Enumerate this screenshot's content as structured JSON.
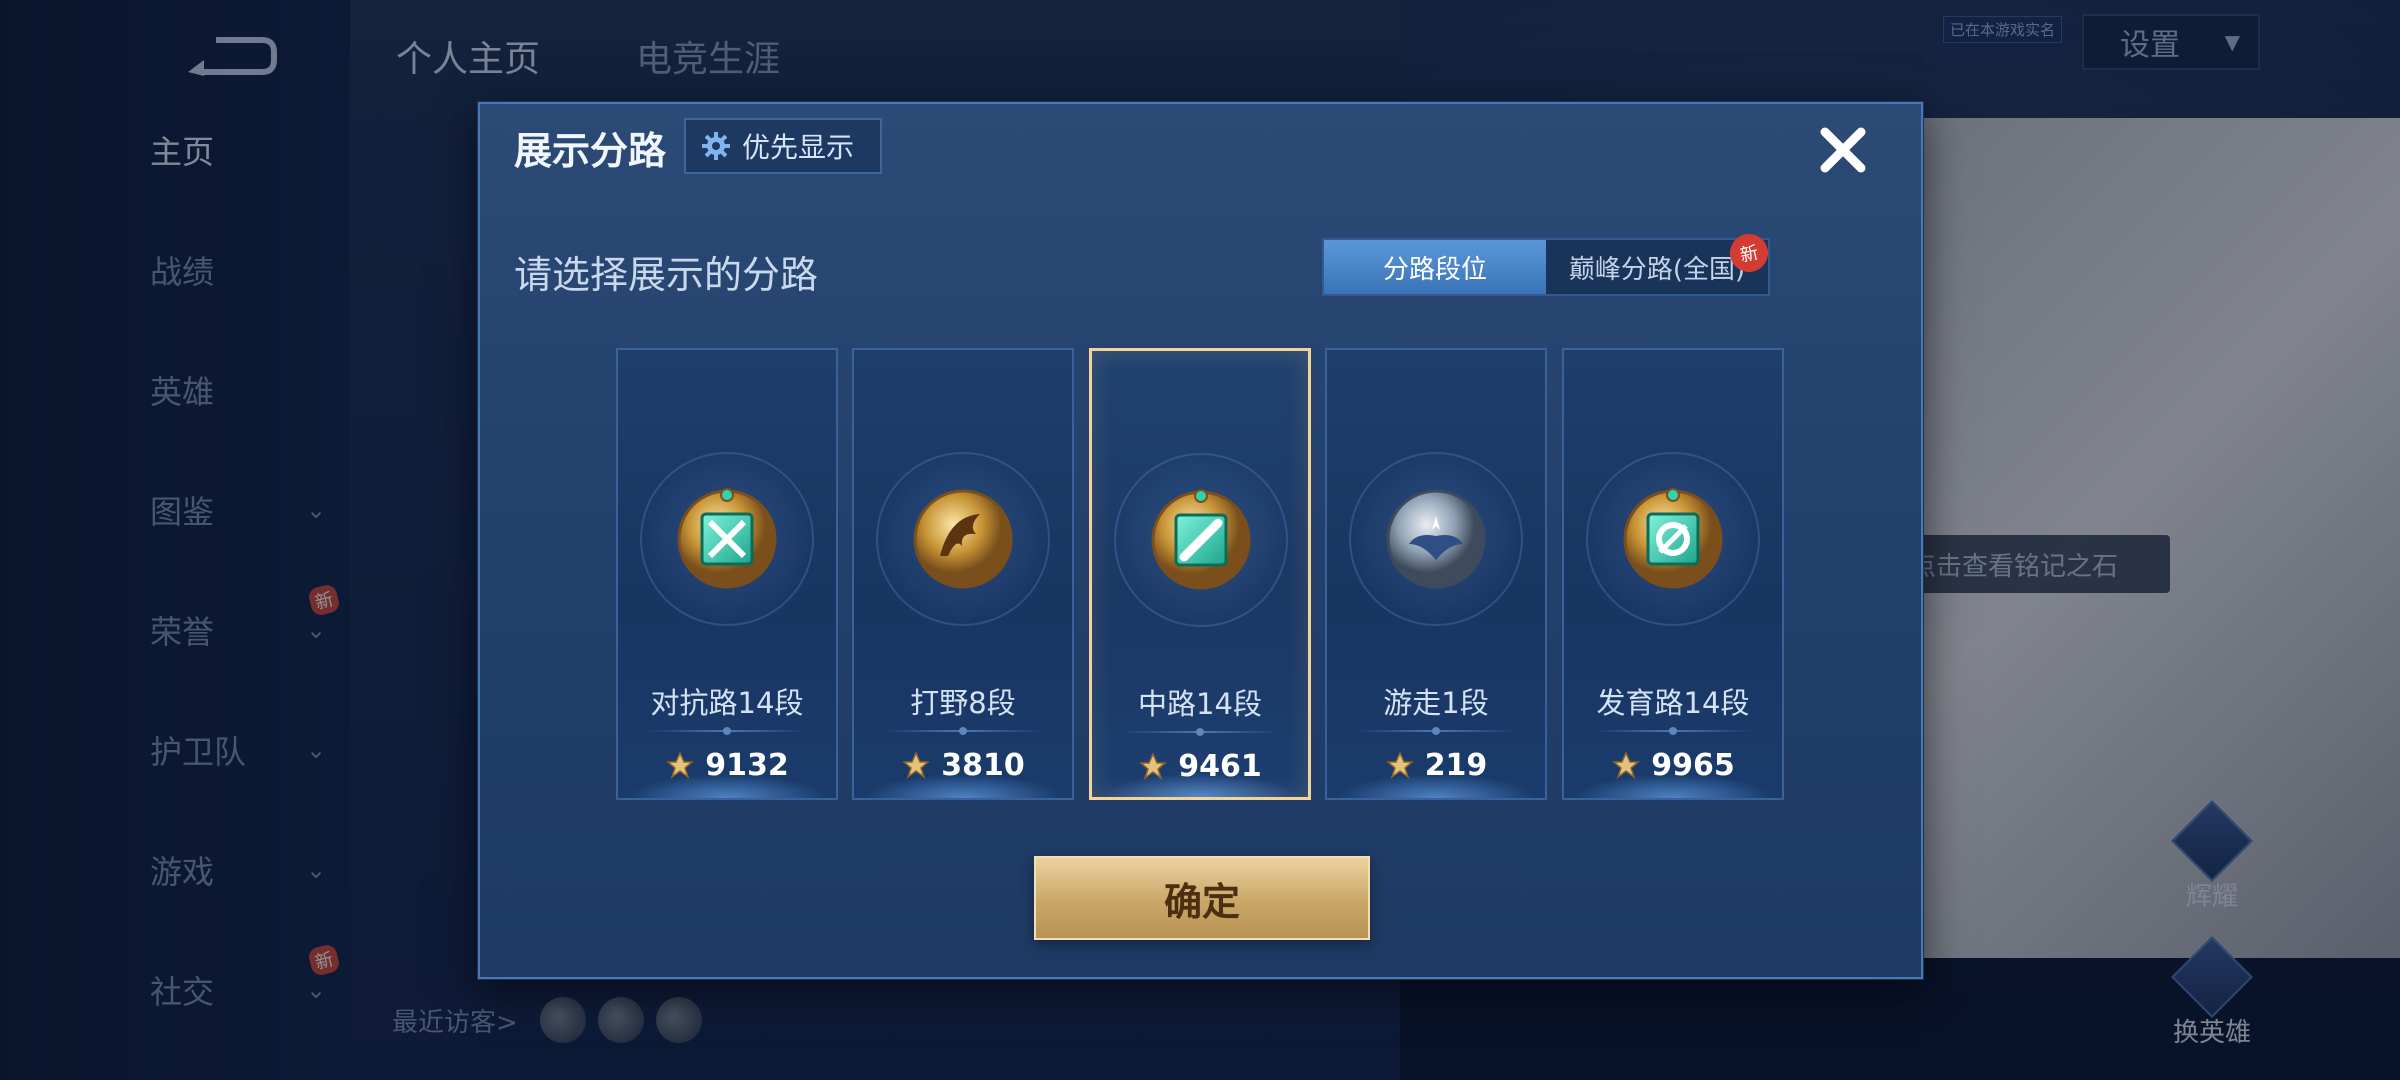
{
  "nav": {
    "items": [
      {
        "label": "主页",
        "active": true,
        "chevron": false,
        "new": false
      },
      {
        "label": "战绩",
        "active": false,
        "chevron": false,
        "new": false
      },
      {
        "label": "英雄",
        "active": false,
        "chevron": false,
        "new": false
      },
      {
        "label": "图鉴",
        "active": false,
        "chevron": true,
        "new": false
      },
      {
        "label": "荣誉",
        "active": false,
        "chevron": true,
        "new": true
      },
      {
        "label": "护卫队",
        "active": false,
        "chevron": true,
        "new": false
      },
      {
        "label": "游戏",
        "active": false,
        "chevron": true,
        "new": false
      },
      {
        "label": "社交",
        "active": false,
        "chevron": true,
        "new": true
      }
    ],
    "new_badge": "新"
  },
  "header": {
    "tabs": [
      "个人主页",
      "电竞生涯"
    ],
    "settings_label": "设置",
    "online_tag": "已在本游戏实名"
  },
  "visitors_label": "最近访客>",
  "hint_text": "点击查看铭记之石",
  "side_buttons": {
    "first": "辉耀",
    "second": "换英雄"
  },
  "dialog": {
    "title": "展示分路",
    "priority_label": "优先显示",
    "prompt": "请选择展示的分路",
    "segment_tabs": [
      "分路段位",
      "巅峰分路(全国)"
    ],
    "segment_new": "新",
    "confirm_label": "确定",
    "lanes": [
      {
        "name": "对抗路14段",
        "score": "9132",
        "emblem": "clash-lane-emblem",
        "selected": false
      },
      {
        "name": "打野8段",
        "score": "3810",
        "emblem": "jungle-emblem",
        "selected": false
      },
      {
        "name": "中路14段",
        "score": "9461",
        "emblem": "mid-lane-emblem",
        "selected": true
      },
      {
        "name": "游走1段",
        "score": "219",
        "emblem": "roam-emblem",
        "selected": false
      },
      {
        "name": "发育路14段",
        "score": "9965",
        "emblem": "farm-lane-emblem",
        "selected": false
      }
    ]
  },
  "colors": {
    "accent_gold": "#f2d39a",
    "tab_active": "#4a86c8",
    "dialog_bg": "#264472"
  }
}
